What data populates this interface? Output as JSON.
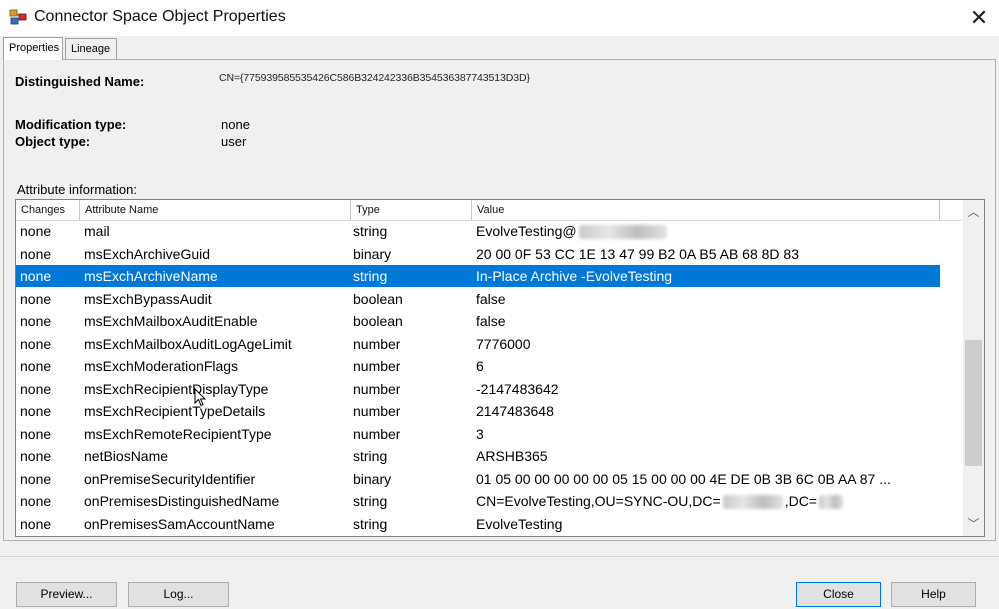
{
  "window": {
    "title": "Connector Space Object Properties"
  },
  "tabs": [
    {
      "label": "Properties"
    },
    {
      "label": "Lineage"
    }
  ],
  "dn": {
    "label": "Distinguished Name:",
    "value": "CN={775939585535426C586B324242336B354536387743513D3D}"
  },
  "modification": {
    "label": "Modification type:",
    "value": "none"
  },
  "object_type": {
    "label": "Object type:",
    "value": "user"
  },
  "attributes": {
    "section_label": "Attribute information:",
    "columns": [
      "Changes",
      "Attribute Name",
      "Type",
      "Value"
    ],
    "rows": [
      {
        "changes": "none",
        "name": "mail",
        "type": "string",
        "value": "EvolveTesting@"
      },
      {
        "changes": "none",
        "name": "msExchArchiveGuid",
        "type": "binary",
        "value": "20 00 0F 53 CC 1E 13 47 99 B2 0A B5 AB 68 8D 83"
      },
      {
        "changes": "none",
        "name": "msExchArchiveName",
        "type": "string",
        "value": "In-Place Archive -EvolveTesting"
      },
      {
        "changes": "none",
        "name": "msExchBypassAudit",
        "type": "boolean",
        "value": "false"
      },
      {
        "changes": "none",
        "name": "msExchMailboxAuditEnable",
        "type": "boolean",
        "value": "false"
      },
      {
        "changes": "none",
        "name": "msExchMailboxAuditLogAgeLimit",
        "type": "number",
        "value": "7776000"
      },
      {
        "changes": "none",
        "name": "msExchModerationFlags",
        "type": "number",
        "value": "6"
      },
      {
        "changes": "none",
        "name": "msExchRecipientDisplayType",
        "type": "number",
        "value": "-2147483642"
      },
      {
        "changes": "none",
        "name": "msExchRecipientTypeDetails",
        "type": "number",
        "value": "2147483648"
      },
      {
        "changes": "none",
        "name": "msExchRemoteRecipientType",
        "type": "number",
        "value": "3"
      },
      {
        "changes": "none",
        "name": "netBiosName",
        "type": "string",
        "value": "ARSHB365"
      },
      {
        "changes": "none",
        "name": "onPremiseSecurityIdentifier",
        "type": "binary",
        "value": "01 05 00 00 00 00 00 05 15 00 00 00 4E DE 0B 3B 6C 0B AA 87 ..."
      },
      {
        "changes": "none",
        "name": "onPremisesDistinguishedName",
        "type": "string",
        "value": "CN=EvolveTesting,OU=SYNC-OU,DC=",
        "value_mid": ",DC="
      },
      {
        "changes": "none",
        "name": "onPremisesSamAccountName",
        "type": "string",
        "value": "EvolveTesting"
      }
    ],
    "selected_index": 2
  },
  "buttons": {
    "preview": "Preview...",
    "log": "Log...",
    "close": "Close",
    "help": "Help"
  },
  "colors": {
    "selection": "#0078d7"
  }
}
